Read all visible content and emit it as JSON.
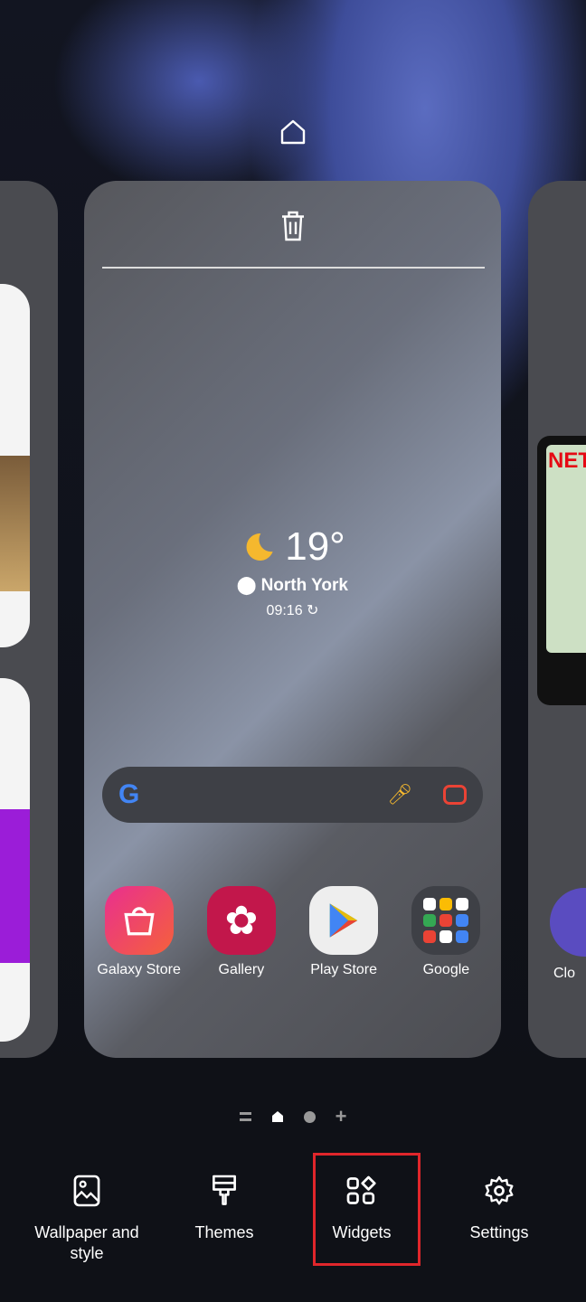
{
  "weather": {
    "temperature": "19°",
    "location": "North York",
    "time": "09:16"
  },
  "apps": [
    {
      "label": "Galaxy Store"
    },
    {
      "label": "Gallery"
    },
    {
      "label": "Play Store"
    },
    {
      "label": "Google"
    }
  ],
  "right_page": {
    "widget_text": "NET",
    "app_label": "Clo"
  },
  "bottom_bar": {
    "wallpaper": "Wallpaper and style",
    "themes": "Themes",
    "widgets": "Widgets",
    "settings": "Settings"
  },
  "colors": {
    "highlight": "#e0262b",
    "weather_moon": "#f5b82e"
  }
}
